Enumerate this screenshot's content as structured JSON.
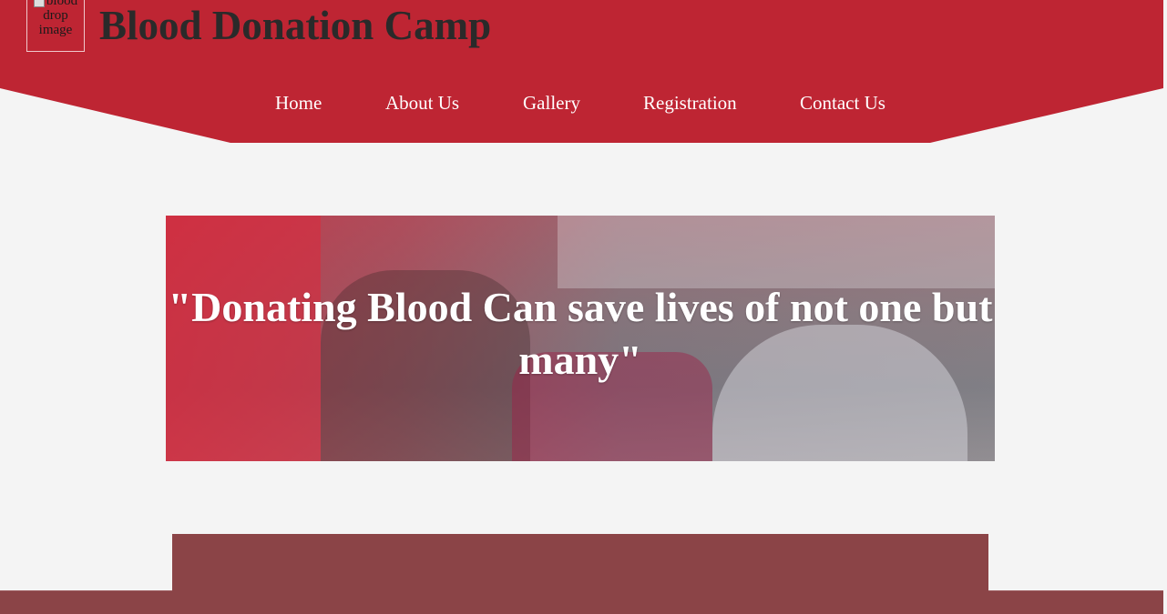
{
  "header": {
    "logo_alt": "blood drop image",
    "title": "Blood Donation Camp",
    "brand_color": "#be2533"
  },
  "nav": {
    "items": [
      {
        "label": "Home"
      },
      {
        "label": "About Us"
      },
      {
        "label": "Gallery"
      },
      {
        "label": "Registration"
      },
      {
        "label": "Contact Us"
      }
    ]
  },
  "hero": {
    "quote": "\"Donating Blood Can save lives of not one but many\""
  },
  "colors": {
    "page_background": "#f4f4f4",
    "content_block": "#8b4447",
    "text_on_brand": "#ffffff",
    "title_text": "#2a2a2a"
  }
}
